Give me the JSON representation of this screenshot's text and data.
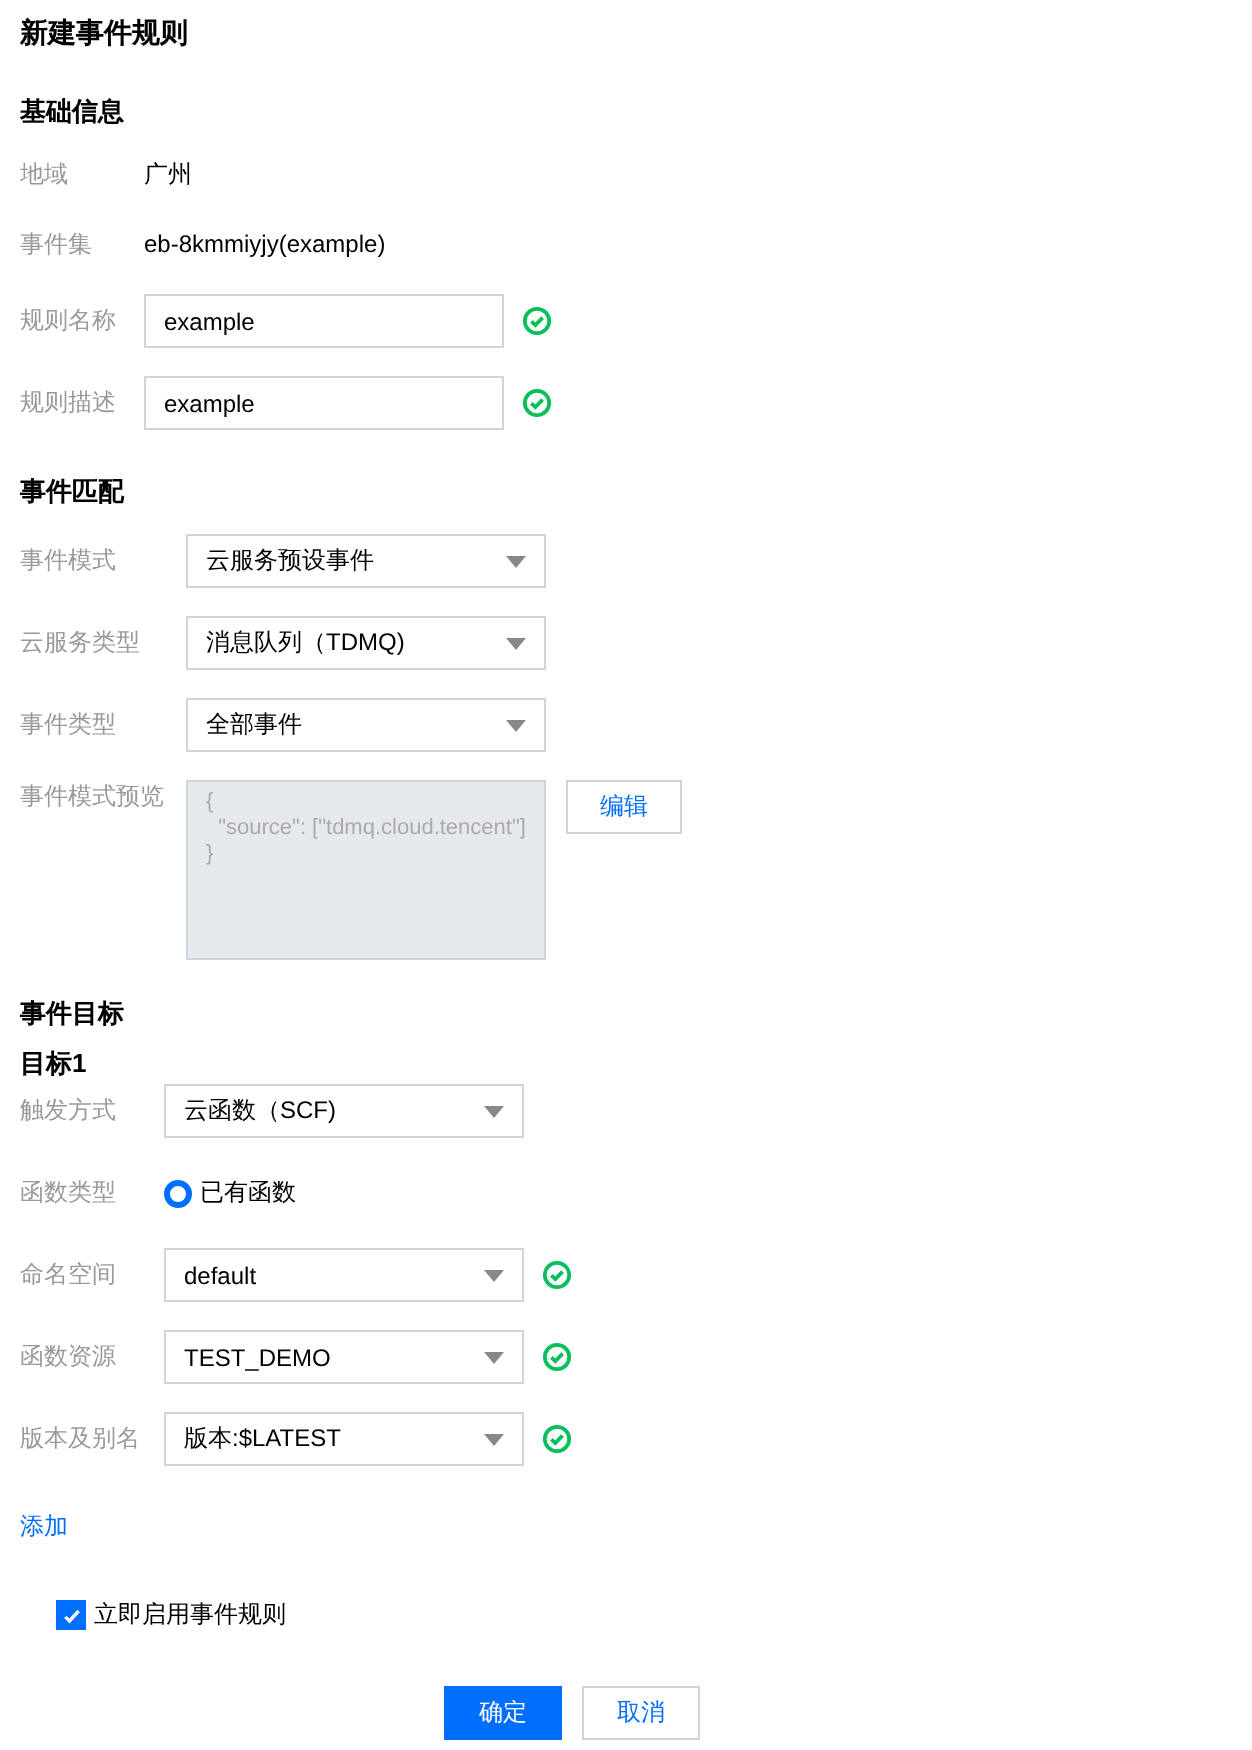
{
  "title": "新建事件规则",
  "sections": [
    {
      "heading": "基础信息",
      "rows": [
        {
          "kind": "text",
          "label": "地域",
          "value": "广州"
        },
        {
          "kind": "text",
          "label": "事件集",
          "value": "eb-8kmmiyjy(example)"
        },
        {
          "kind": "input",
          "label": "规则名称",
          "value": "example",
          "valid": true
        },
        {
          "kind": "input",
          "label": "规则描述",
          "value": "example",
          "valid": true
        }
      ]
    },
    {
      "heading": "事件匹配",
      "rows": [
        {
          "kind": "select",
          "label": "事件模式",
          "value": "云服务预设事件"
        },
        {
          "kind": "select",
          "label": "云服务类型",
          "value": "消息队列（TDMQ)"
        },
        {
          "kind": "select",
          "label": "事件类型",
          "value": "全部事件"
        },
        {
          "kind": "preview",
          "label": "事件模式预览",
          "lines": [
            "{",
            "  \"source\": [\"tdmq.cloud.tencent\"]",
            "}"
          ],
          "button": "编辑"
        }
      ]
    },
    {
      "heading": "事件目标",
      "subheading": "目标1",
      "rows": [
        {
          "kind": "select",
          "label": "触发方式",
          "value": "云函数（SCF)"
        },
        {
          "kind": "radio",
          "label": "函数类型",
          "value": "已有函数",
          "selected": true
        },
        {
          "kind": "select",
          "label": "命名空间",
          "value": "default",
          "valid": true
        },
        {
          "kind": "select",
          "label": "函数资源",
          "value": "TEST_DEMO",
          "valid": true
        },
        {
          "kind": "select",
          "label": "版本及别名",
          "value": "版本:$LATEST",
          "valid": true
        }
      ]
    }
  ],
  "add_link": "添加",
  "enable": {
    "label": "立即启用事件规则",
    "checked": true
  },
  "buttons": [
    {
      "label": "确定",
      "primary": true
    },
    {
      "label": "取消",
      "primary": false
    }
  ]
}
